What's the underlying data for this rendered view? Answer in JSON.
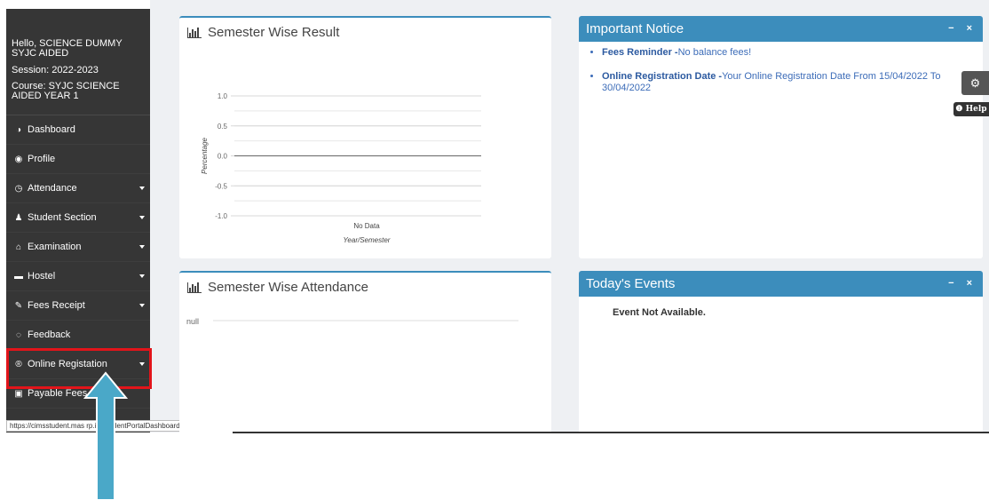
{
  "sidebar": {
    "hello": "Hello, SCIENCE DUMMY SYJC AIDED",
    "session": "Session: 2022-2023",
    "course": "Course: SYJC SCIENCE AIDED YEAR 1",
    "items": [
      {
        "label": "Dashboard",
        "icon": "dashboard-icon",
        "glyph": "◑",
        "caret": false
      },
      {
        "label": "Profile",
        "icon": "user-circle-icon",
        "glyph": "◉",
        "caret": false
      },
      {
        "label": "Attendance",
        "icon": "clock-icon",
        "glyph": "◷",
        "caret": true
      },
      {
        "label": "Student Section",
        "icon": "user-icon",
        "glyph": "♟",
        "caret": true
      },
      {
        "label": "Examination",
        "icon": "institution-icon",
        "glyph": "⌂",
        "caret": true
      },
      {
        "label": "Hostel",
        "icon": "bed-icon",
        "glyph": "▬",
        "caret": true
      },
      {
        "label": "Fees Receipt",
        "icon": "pencil-icon",
        "glyph": "✎",
        "caret": true
      },
      {
        "label": "Feedback",
        "icon": "comment-icon",
        "glyph": "◌",
        "caret": false
      },
      {
        "label": "Online Registation",
        "icon": "registered-icon",
        "glyph": "®",
        "caret": true
      },
      {
        "label": "Payable Fees",
        "icon": "money-icon",
        "glyph": "▣",
        "caret": false
      }
    ]
  },
  "status_url": "https://cimsstudent.mas   rp.in/StudentPortalDashboard#",
  "result_panel": {
    "title": "Semester Wise Result"
  },
  "attendance_panel": {
    "title": "Semester Wise Attendance",
    "null_label": "null"
  },
  "notice_panel": {
    "title": "Important Notice",
    "minimize": "−",
    "close": "×",
    "items": [
      {
        "heading": "Fees Reminder -",
        "text": "No balance fees!"
      },
      {
        "heading": "Online Registration Date -",
        "text": "Your Online Registration Date From 15/04/2022 To 30/04/2022"
      }
    ]
  },
  "events_panel": {
    "title": "Today's Events",
    "minimize": "−",
    "close": "×",
    "empty_text": "Event Not Available."
  },
  "floating": {
    "gear": "⚙",
    "help": "❶ Help"
  },
  "colors": {
    "accent": "#3c8dbc",
    "sidebar": "#363636",
    "highlight": "#e2141a",
    "arrow": "#4aa8c8"
  },
  "chart_data": {
    "type": "line",
    "xlabel": "Year/Semester",
    "ylabel": "Percentage",
    "categories": [
      "No Data"
    ],
    "series": [
      {
        "values": [
          0
        ]
      }
    ],
    "ylim": [
      -1.0,
      1.0
    ],
    "yticks": [
      "1.0",
      "0.5",
      "0.0",
      "-0.5",
      "-1.0"
    ]
  }
}
